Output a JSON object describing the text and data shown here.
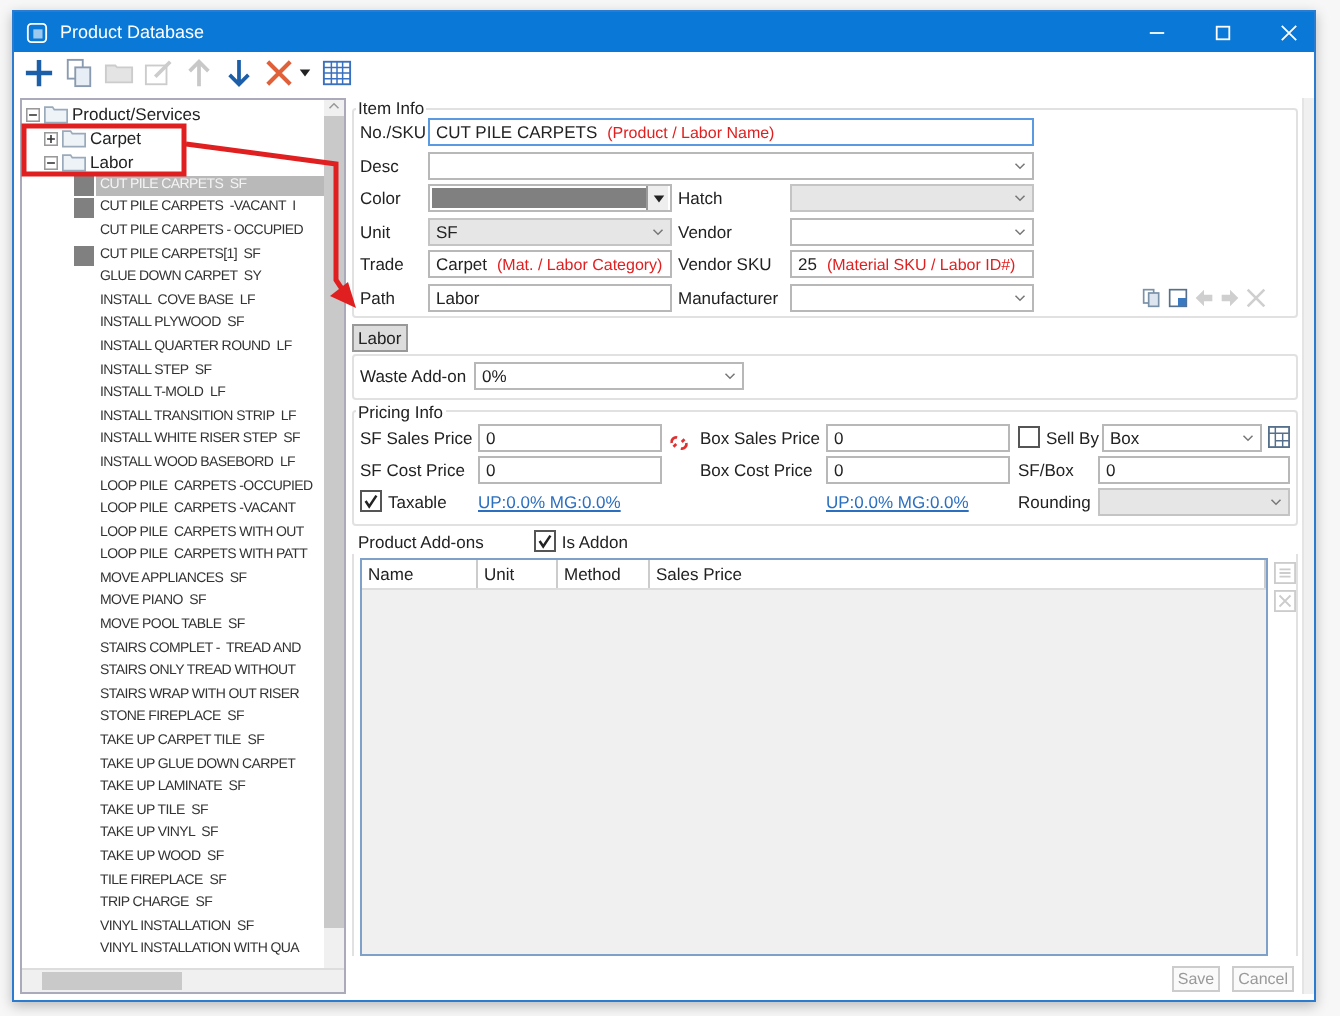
{
  "window": {
    "title": "Product Database"
  },
  "toolbar": [
    {
      "kind": "add",
      "disabled": false
    },
    {
      "kind": "copy",
      "disabled": false
    },
    {
      "kind": "folder",
      "disabled": true
    },
    {
      "kind": "edit",
      "disabled": true
    },
    {
      "kind": "up",
      "disabled": true
    },
    {
      "kind": "down",
      "disabled": false
    },
    {
      "kind": "delete",
      "disabled": false
    },
    {
      "kind": "caret",
      "disabled": false
    },
    {
      "kind": "grid",
      "disabled": false
    }
  ],
  "tree": {
    "root": "Product/Services",
    "children": [
      {
        "label": "Carpet",
        "expanded": false
      },
      {
        "label": "Labor",
        "expanded": true,
        "children": [
          {
            "label": "CUT PILE CARPETS  SF",
            "selected": true,
            "color": "#808080"
          },
          {
            "label": "CUT PILE CARPETS  -VACANT  I",
            "selected": false,
            "color": "#808080"
          },
          {
            "label": "CUT PILE CARPETS - OCCUPIED",
            "selected": false
          },
          {
            "label": "CUT PILE CARPETS[1]  SF",
            "selected": false,
            "color": "#808080"
          },
          {
            "label": "GLUE DOWN CARPET  SY",
            "selected": false
          },
          {
            "label": "INSTALL  COVE BASE  LF",
            "selected": false
          },
          {
            "label": "INSTALL PLYWOOD  SF",
            "selected": false
          },
          {
            "label": "INSTALL QUARTER ROUND  LF",
            "selected": false
          },
          {
            "label": "INSTALL STEP  SF",
            "selected": false
          },
          {
            "label": "INSTALL T-MOLD  LF",
            "selected": false
          },
          {
            "label": "INSTALL TRANSITION STRIP  LF",
            "selected": false
          },
          {
            "label": "INSTALL WHITE RISER STEP  SF",
            "selected": false
          },
          {
            "label": "INSTALL WOOD BASEBORD  LF",
            "selected": false
          },
          {
            "label": "LOOP PILE  CARPETS -OCCUPIED",
            "selected": false
          },
          {
            "label": "LOOP PILE  CARPETS -VACANT",
            "selected": false
          },
          {
            "label": "LOOP PILE  CARPETS WITH OUT",
            "selected": false
          },
          {
            "label": "LOOP PILE  CARPETS WITH PATT",
            "selected": false
          },
          {
            "label": "MOVE APPLIANCES  SF",
            "selected": false
          },
          {
            "label": "MOVE PIANO  SF",
            "selected": false
          },
          {
            "label": "MOVE POOL TABLE  SF",
            "selected": false
          },
          {
            "label": "STAIRS COMPLET -  TREAD AND",
            "selected": false
          },
          {
            "label": "STAIRS ONLY TREAD WITHOUT",
            "selected": false
          },
          {
            "label": "STAIRS WRAP WITH OUT RISER",
            "selected": false
          },
          {
            "label": "STONE FIREPLACE  SF",
            "selected": false
          },
          {
            "label": "TAKE UP CARPET TILE  SF",
            "selected": false
          },
          {
            "label": "TAKE UP GLUE DOWN CARPET",
            "selected": false
          },
          {
            "label": "TAKE UP LAMINATE  SF",
            "selected": false
          },
          {
            "label": "TAKE UP TILE  SF",
            "selected": false
          },
          {
            "label": "TAKE UP VINYL  SF",
            "selected": false
          },
          {
            "label": "TAKE UP WOOD  SF",
            "selected": false
          },
          {
            "label": "TILE FIREPLACE  SF",
            "selected": false
          },
          {
            "label": "TRIP CHARGE  SF",
            "selected": false
          },
          {
            "label": "VINYL INSTALLATION  SF",
            "selected": false
          },
          {
            "label": "VINYL INSTALLATION WITH QUA",
            "selected": false
          }
        ]
      }
    ]
  },
  "item_info": {
    "title": "Item Info",
    "rows": [
      {
        "fields": [
          {
            "label": "No./SKU",
            "kind": "text",
            "value": "CUT PILE CARPETS",
            "note": "(Product / Labor Name)",
            "focused": true
          }
        ]
      },
      {
        "fields": [
          {
            "label": "Desc",
            "kind": "dropdown",
            "disabled": false
          }
        ]
      },
      {
        "fields": [
          {
            "label": "Color",
            "kind": "color",
            "color": "#808080"
          },
          {
            "label": "Hatch",
            "kind": "dropdown",
            "disabled": true
          }
        ]
      },
      {
        "fields": [
          {
            "label": "Unit",
            "kind": "dropdown",
            "value": "SF",
            "disabled": true
          },
          {
            "label": "Vendor",
            "kind": "dropdown",
            "disabled": false
          }
        ]
      },
      {
        "fields": [
          {
            "label": "Trade",
            "kind": "text",
            "value": "Carpet",
            "note": "(Mat. / Labor Category)",
            "focused": false
          },
          {
            "label": "Vendor SKU",
            "kind": "text",
            "value": "25",
            "note": "(Material SKU / Labor ID#)",
            "focused": false
          }
        ]
      },
      {
        "fields": [
          {
            "label": "Path",
            "kind": "text",
            "value": "Labor",
            "focused": false
          },
          {
            "label": "Manufacturer",
            "kind": "dropdown",
            "disabled": false
          }
        ]
      }
    ],
    "actions": [
      {
        "kind": "copy",
        "disabled": false
      },
      {
        "kind": "save",
        "disabled": false
      },
      {
        "kind": "left",
        "disabled": true
      },
      {
        "kind": "right",
        "disabled": true
      },
      {
        "kind": "delete",
        "disabled": true
      }
    ]
  },
  "tabs": [
    {
      "label": "Labor",
      "selected": true
    }
  ],
  "waste": {
    "label": "Waste Add-on",
    "value": "0%"
  },
  "pricing": {
    "title": "Pricing Info",
    "sf_sales": {
      "label": "SF Sales Price",
      "value": "0"
    },
    "sf_cost": {
      "label": "SF Cost Price",
      "value": "0"
    },
    "box_sales": {
      "label": "Box Sales Price",
      "value": "0"
    },
    "box_cost": {
      "label": "Box Cost Price",
      "value": "0"
    },
    "sell_by": {
      "label": "Sell By",
      "checked": false,
      "value": "Box"
    },
    "sf_box": {
      "label": "SF/Box",
      "value": "0"
    },
    "taxable": {
      "label": "Taxable",
      "checked": true
    },
    "links": [
      "UP:0.0% MG:0.0%",
      "UP:0.0% MG:0.0%"
    ],
    "rounding": {
      "label": "Rounding",
      "disabled": true
    }
  },
  "addons": {
    "title": "Product Add-ons",
    "is_addon": {
      "label": "Is Addon",
      "checked": true
    },
    "columns": [
      "Name",
      "Unit",
      "Method",
      "Sales Price"
    ]
  },
  "buttons": [
    {
      "label": "Save",
      "disabled": true
    },
    {
      "label": "Cancel",
      "disabled": true
    }
  ]
}
